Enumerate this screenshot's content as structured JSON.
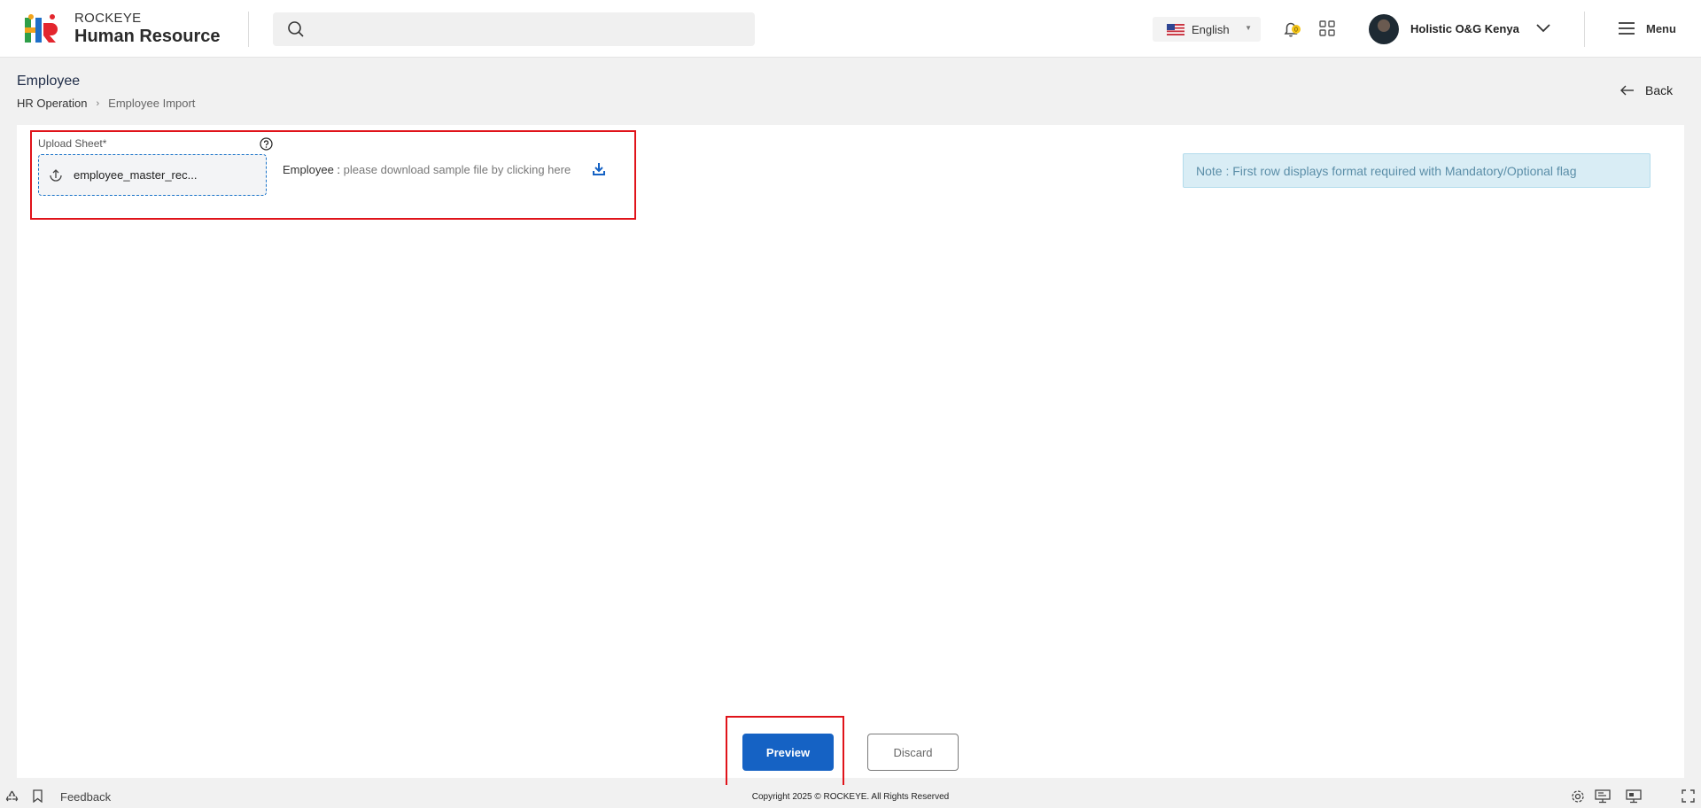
{
  "header": {
    "brand_top": "ROCKEYE",
    "brand_bottom": "Human Resource",
    "language": "English",
    "notification_count": "0",
    "user_name": "Holistic O&G Kenya",
    "menu_label": "Menu"
  },
  "page": {
    "title": "Employee",
    "breadcrumb": [
      "HR Operation",
      "Employee Import"
    ],
    "back_label": "Back"
  },
  "upload": {
    "label": "Upload Sheet*",
    "file_name": "employee_master_rec...",
    "sample_prefix": "Employee :",
    "sample_text": "please download sample file by clicking here"
  },
  "note": "Note : First row displays format required with Mandatory/Optional flag",
  "actions": {
    "preview": "Preview",
    "discard": "Discard"
  },
  "footer": {
    "feedback": "Feedback",
    "copyright": "Copyright 2025 © ROCKEYE. All Rights Reserved"
  },
  "colors": {
    "primary": "#1562c4",
    "highlight": "#e0131a",
    "note_bg": "#d9edf5"
  }
}
